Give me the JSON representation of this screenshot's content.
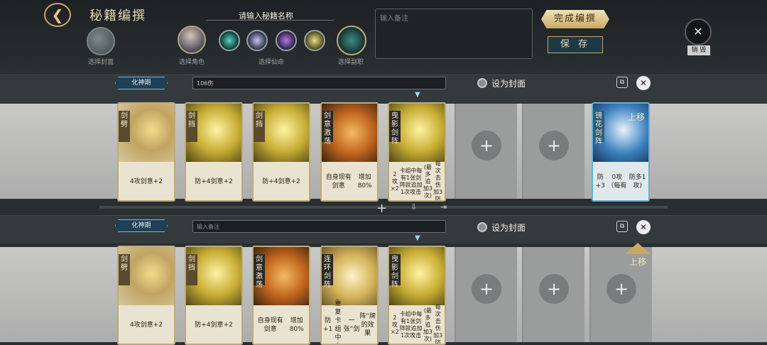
{
  "header": {
    "title": "秘籍编撰",
    "name_prompt": "请输入秘籍名称",
    "note_placeholder": "输入备注",
    "done_label": "完成编撰",
    "save_label": "保 存",
    "destroy_label": "销 毁",
    "select_cover_label": "选择封面",
    "select_role_label": "选择角色",
    "select_fate_label": "选择仙命",
    "select_career_label": "选择副职"
  },
  "rows": [
    {
      "realm": "化神期",
      "note": "106伤",
      "set_cover": "设为封面",
      "cards": [
        {
          "name": "剑劈",
          "desc": [
            "4攻",
            "剑意+2"
          ]
        },
        {
          "name": "剑挡",
          "desc": [
            "防+4",
            "剑意+2"
          ]
        },
        {
          "name": "剑挡",
          "desc": [
            "防+4",
            "剑意+2"
          ]
        },
        {
          "name": "剑意激荡",
          "desc": [
            "自身现有剑意",
            "增加80%"
          ]
        },
        {
          "name": "曳影剑阵",
          "desc": [
            "2攻×2",
            "卡组中每有1张剑阵就追加1次攻击",
            "(最多追加3次)",
            "每次击伤加3防"
          ]
        }
      ],
      "special_card": {
        "name": "镜花剑阵",
        "desc": [
          "防+3",
          "0攻（每有",
          "防多1攻)"
        ]
      },
      "move_up": "上移"
    },
    {
      "realm": "化神期",
      "note_placeholder": "输入备注",
      "set_cover": "设为封面",
      "cards": [
        {
          "name": "剑劈",
          "desc": [
            "4攻",
            "剑意+2"
          ]
        },
        {
          "name": "剑挡",
          "desc": [
            "防+4",
            "剑意+2"
          ]
        },
        {
          "name": "剑意激荡",
          "desc": [
            "自身现有剑意",
            "增加80%"
          ]
        },
        {
          "name": "连环剑阵",
          "desc": [
            "防+1",
            "重复卡组中上",
            "一张“剑",
            "阵”牌的效果"
          ]
        },
        {
          "name": "曳影剑阵",
          "desc": [
            "2攻×2",
            "卡组中每有1张剑阵就追加1次攻击",
            "(最多追加3次)",
            "每次击伤加3防"
          ]
        }
      ],
      "move_up": "上移"
    }
  ],
  "icons": {
    "back": "back-arrow-icon",
    "add": "plus-icon",
    "copy": "copy-icon",
    "delete": "close-icon"
  }
}
